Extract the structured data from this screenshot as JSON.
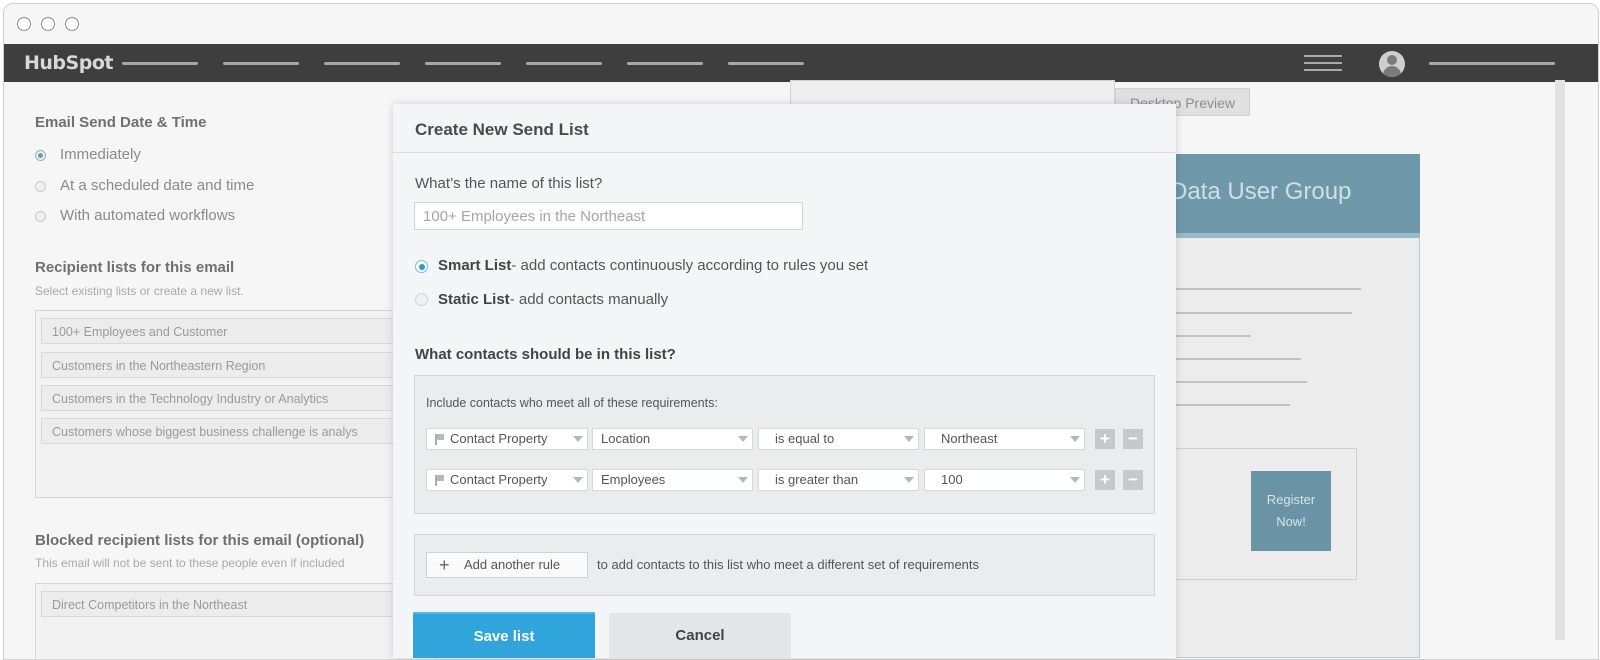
{
  "navbar": {
    "logo": "HubSpot"
  },
  "background": {
    "send_heading": "Email Send Date & Time",
    "send_options": [
      "Immediately",
      "At a scheduled date and time",
      "With automated workflows"
    ],
    "recipient_heading": "Recipient lists for this email",
    "recipient_sub": "Select existing lists or create a new list.",
    "recipient_lists": [
      "100+ Employees and Customer",
      "Customers in the Northeastern Region",
      "Customers in the Technology Industry or Analytics",
      "Customers whose biggest business challenge is analys"
    ],
    "blocked_heading": "Blocked recipient lists for this email (optional)",
    "blocked_sub": "This email will not be sent to these people even if included",
    "blocked_lists": [
      "Direct Competitors in the Northeast"
    ],
    "preview_tab": "Desktop Preview",
    "preview_title": "Data User Group",
    "register_button": "Register Now!"
  },
  "modal": {
    "title": "Create New Send List",
    "name_question": "What’s the name of this list?",
    "name_value": "100+ Employees in the Northeast",
    "smart_list": {
      "label": "Smart List",
      "desc": "- add contacts continuously according to rules you set",
      "selected": true
    },
    "static_list": {
      "label": "Static List",
      "desc": "- add contacts manually",
      "selected": false
    },
    "contacts_question": "What contacts should be in this list?",
    "rules_hint": "Include contacts who meet all of these requirements:",
    "rules": [
      {
        "type": "Contact Property",
        "property": "Location",
        "operator": "is equal to",
        "value": "Northeast"
      },
      {
        "type": "Contact Property",
        "property": "Employees",
        "operator": "is greater than",
        "value": "100"
      }
    ],
    "add_rule_button": "Add another rule",
    "add_rule_text": "to add contacts to this list who meet a different set of requirements",
    "save_button": "Save list",
    "cancel_button": "Cancel"
  }
}
